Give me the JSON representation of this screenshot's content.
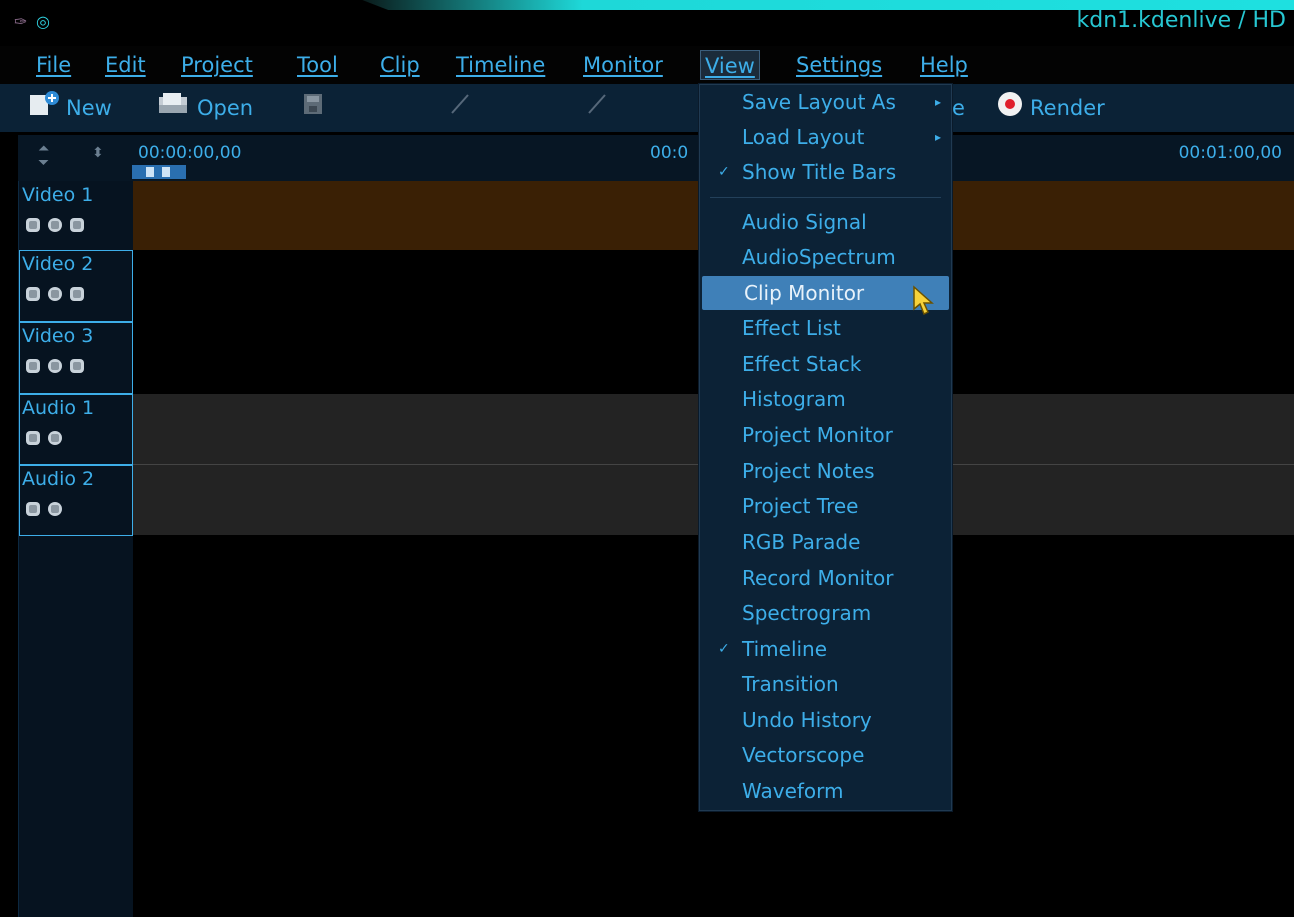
{
  "window": {
    "title": "kdn1.kdenlive / HD"
  },
  "menubar": {
    "items": [
      "File",
      "Edit",
      "Project",
      "Tool",
      "Clip",
      "Timeline",
      "Monitor",
      "View",
      "Settings",
      "Help"
    ],
    "active": "View"
  },
  "toolbar": {
    "new_label": "New",
    "open_label": "Open",
    "render_label": "Render",
    "partial_label": "e"
  },
  "ruler": {
    "start": "00:00:00,00",
    "middle": "00:0",
    "end": "00:01:00,00"
  },
  "tracks": [
    {
      "name": "Video 1",
      "type": "video"
    },
    {
      "name": "Video 2",
      "type": "video"
    },
    {
      "name": "Video 3",
      "type": "video"
    },
    {
      "name": "Audio 1",
      "type": "audio"
    },
    {
      "name": "Audio 2",
      "type": "audio"
    }
  ],
  "view_menu": {
    "items": [
      {
        "label": "Save Layout As",
        "submenu": true
      },
      {
        "label": "Load Layout",
        "submenu": true
      },
      {
        "label": "Show Title Bars",
        "checked": true
      },
      {
        "label": "Audio Signal"
      },
      {
        "label": "AudioSpectrum"
      },
      {
        "label": "Clip Monitor",
        "hovered": true
      },
      {
        "label": "Effect List"
      },
      {
        "label": "Effect Stack"
      },
      {
        "label": "Histogram"
      },
      {
        "label": "Project Monitor"
      },
      {
        "label": "Project Notes"
      },
      {
        "label": "Project Tree"
      },
      {
        "label": "RGB Parade"
      },
      {
        "label": "Record Monitor"
      },
      {
        "label": "Spectrogram"
      },
      {
        "label": "Timeline",
        "checked": true
      },
      {
        "label": "Transition"
      },
      {
        "label": "Undo History"
      },
      {
        "label": "Vectorscope"
      },
      {
        "label": "Waveform"
      }
    ]
  },
  "colors": {
    "accent": "#3daee9",
    "video1_lane": "#3a2005",
    "audio_lane": "#232323",
    "hover": "#3f80b8"
  }
}
